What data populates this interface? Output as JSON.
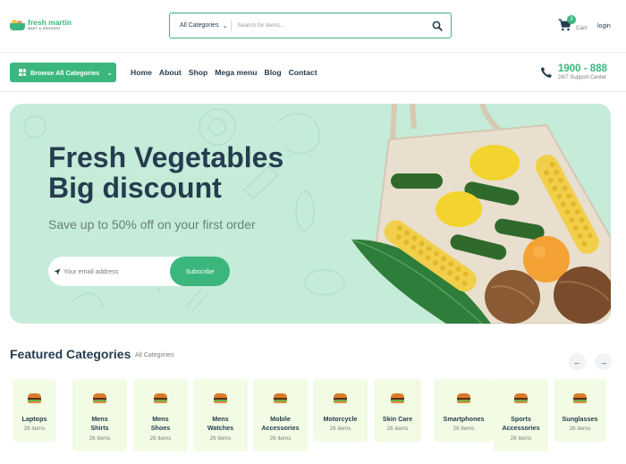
{
  "header": {
    "logo": {
      "name": "fresh martin",
      "tagline": "MART & GROCERY"
    },
    "search": {
      "category": "All Categories",
      "placeholder": "Search for items..."
    },
    "cart": {
      "count": "3",
      "label": "Cart"
    },
    "login": "login"
  },
  "nav": {
    "browse_label": "Browse All  Categories",
    "menu": [
      "Home",
      "About",
      "Shop",
      "Mega menu",
      "Blog",
      "Contact"
    ],
    "support": {
      "phone": "1900 - 888",
      "label": "24/7 Support Center"
    }
  },
  "hero": {
    "title_line1": "Fresh Vegetables",
    "title_line2": "Big discount",
    "subtitle": "Save up to 50% off on your first order",
    "email_placeholder": "Your email address",
    "subscribe_label": "Subscribe"
  },
  "featured": {
    "title": "Featured Categories",
    "all_link": "All Categories",
    "categories": [
      {
        "name_lines": [
          "Laptops"
        ],
        "count": "26 items"
      },
      {
        "name_lines": [
          "Mens",
          "Shirts"
        ],
        "count": "26 items"
      },
      {
        "name_lines": [
          "Mens",
          "Shoes"
        ],
        "count": "26 items"
      },
      {
        "name_lines": [
          "Mens",
          "Watches"
        ],
        "count": "26 items"
      },
      {
        "name_lines": [
          "Mobile",
          "Accessories"
        ],
        "count": "26 items"
      },
      {
        "name_lines": [
          "Motorcycle"
        ],
        "count": "26 items"
      },
      {
        "name_lines": [
          "Skin Care"
        ],
        "count": "26 items"
      },
      {
        "name_lines": [
          "Smartphones"
        ],
        "count": "26 items"
      },
      {
        "name_lines": [
          "Sports",
          "Accessories"
        ],
        "count": "26 items"
      },
      {
        "name_lines": [
          "Sunglasses"
        ],
        "count": "26 items"
      }
    ]
  },
  "colors": {
    "brand": "#3bb77e",
    "heading": "#253d4e",
    "hero_bg": "#c5ebd9",
    "card_bg": "#f2fce4"
  }
}
